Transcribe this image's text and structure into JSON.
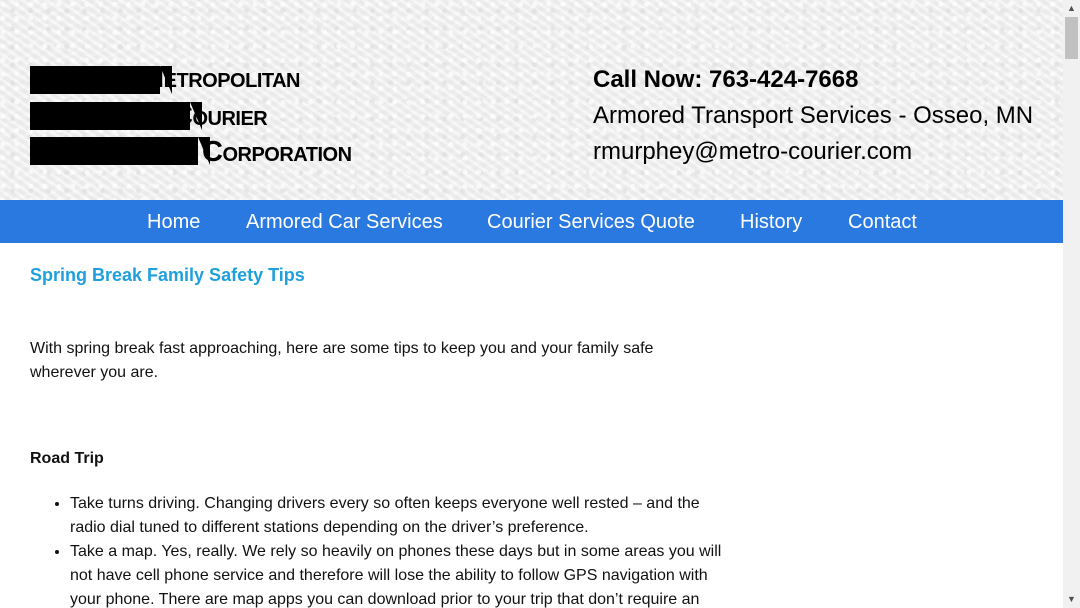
{
  "header": {
    "logo": {
      "line1": "Metropolitan",
      "line2": "Courier",
      "line3": "Corporation"
    },
    "call_now": "Call Now: 763-424-7668",
    "tagline": "Armored Transport Services - Osseo, MN",
    "email": "rmurphey@metro-courier.com"
  },
  "nav": {
    "items": [
      {
        "label": "Home"
      },
      {
        "label": "Armored Car Services"
      },
      {
        "label": "Courier Services Quote"
      },
      {
        "label": "History"
      },
      {
        "label": "Contact"
      }
    ]
  },
  "post": {
    "title": "Spring Break Family Safety Tips",
    "intro": "With spring break fast approaching, here are some tips to keep you and your family safe wherever you are.",
    "section_heading": "Road Trip",
    "tips": [
      "Take turns driving. Changing drivers every so often keeps everyone well rested – and the radio dial tuned to different stations depending on the driver’s preference.",
      "Take a map. Yes, really. We rely so heavily on phones these days but in some areas you will not have cell phone service and therefore will lose the ability to follow GPS navigation with your phone. There are map apps you can download prior to your trip that don’t require an"
    ]
  },
  "scrollbar": {
    "up_icon": "triangle-up-icon",
    "down_icon": "triangle-down-icon"
  }
}
